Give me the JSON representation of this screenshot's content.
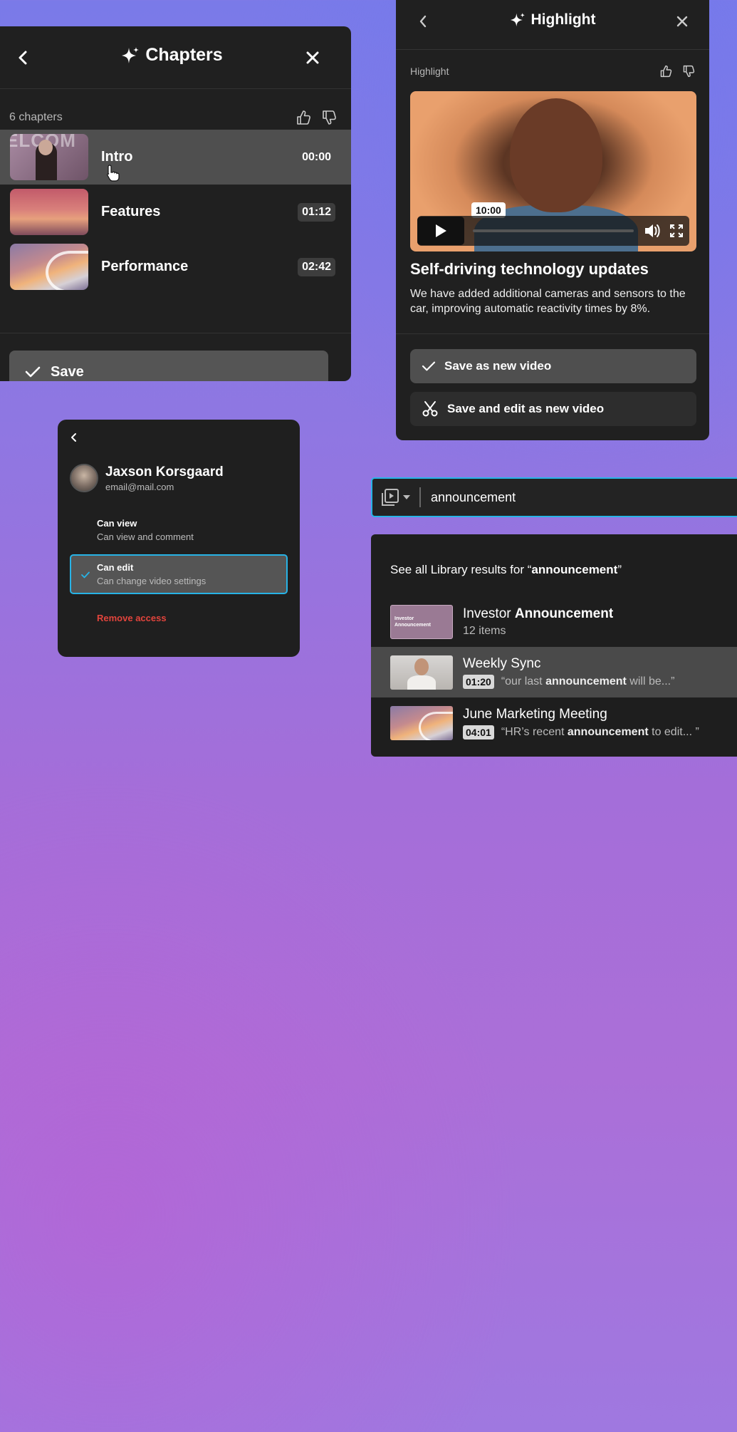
{
  "chapters": {
    "title": "Chapters",
    "count_label": "6 chapters",
    "items": [
      {
        "label": "Intro",
        "time": "00:00"
      },
      {
        "label": "Features",
        "time": "01:12"
      },
      {
        "label": "Performance",
        "time": "02:42"
      }
    ],
    "intro_thumb_text": "ELCOM",
    "save_label": "Save"
  },
  "highlight": {
    "title": "Highlight",
    "section_label": "Highlight",
    "video_time": "10:00",
    "video_title": "Self-driving technology updates",
    "video_desc": "We have added additional cameras and sensors to the car, improving automatic reactivity times by 8%.",
    "save_new_label": "Save as new video",
    "save_edit_label": "Save and edit as new video"
  },
  "share": {
    "user_name": "Jaxson Korsgaard",
    "user_email": "email@mail.com",
    "permissions": [
      {
        "title": "Can view",
        "desc": "Can view and comment",
        "selected": false
      },
      {
        "title": "Can edit",
        "desc": "Can change video settings",
        "selected": true
      }
    ],
    "remove_label": "Remove access"
  },
  "search": {
    "query": "announcement",
    "see_all_prefix": "See all Library results for “",
    "see_all_term": "announcement",
    "see_all_suffix": "”",
    "results": [
      {
        "title_plain": "Investor ",
        "title_bold": "Announcement",
        "sub": "12 items",
        "thumb_text": "Investor Announcement"
      },
      {
        "title": "Weekly Sync",
        "timecode": "01:20",
        "quote_pre": "“our last ",
        "quote_bold": "announcement",
        "quote_post": " will be...”"
      },
      {
        "title": "June Marketing Meeting",
        "timecode": "04:01",
        "quote_pre": "“HR’s recent ",
        "quote_bold": "announcement",
        "quote_post": " to edit... ”"
      }
    ]
  },
  "colors": {
    "accent_blue": "#27b3e6",
    "danger_red": "#e2443c",
    "panel_bg": "#202020"
  },
  "icons": [
    "back-chevron-icon",
    "sparkle-icon",
    "close-icon",
    "thumbs-up-icon",
    "thumbs-down-icon",
    "check-icon",
    "play-icon",
    "volume-icon",
    "fullscreen-icon",
    "scissors-icon",
    "library-video-icon",
    "caret-down-icon",
    "cursor-hand-icon"
  ]
}
